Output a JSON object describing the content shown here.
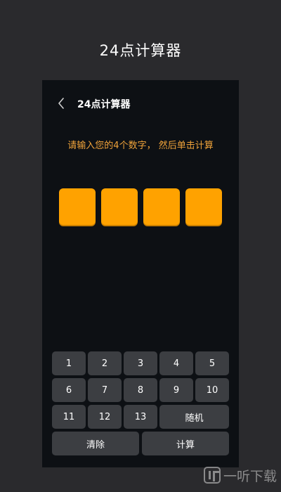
{
  "promo": {
    "title": "24点计算器"
  },
  "app": {
    "title": "24点计算器",
    "instruction": "请输入您的4个数字， 然后单击计算",
    "slots": [
      "",
      "",
      "",
      ""
    ],
    "colors": {
      "accent": "#ffa200",
      "instruction": "#f0a33a",
      "key_bg": "#3c3e42",
      "screen_bg": "#0d1014"
    }
  },
  "keypad": {
    "row1": [
      "1",
      "2",
      "3",
      "4",
      "5"
    ],
    "row2": [
      "6",
      "7",
      "8",
      "9",
      "10"
    ],
    "row3": [
      "11",
      "12",
      "13"
    ],
    "random": "随机",
    "clear": "清除",
    "calculate": "计算"
  },
  "watermark": {
    "text": "一听下载"
  }
}
